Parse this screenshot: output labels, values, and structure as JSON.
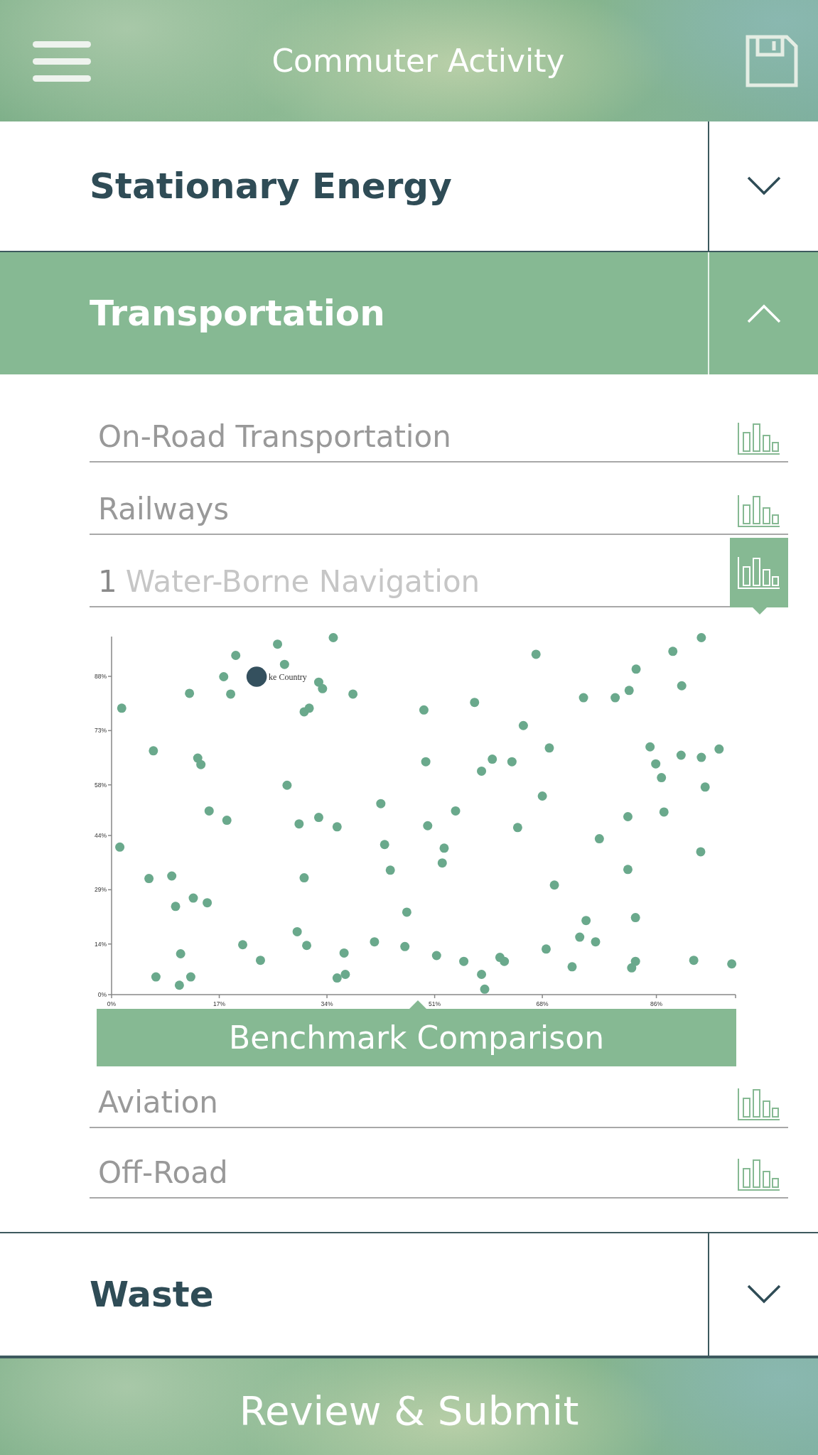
{
  "header": {
    "title": "Commuter Activity"
  },
  "sections": [
    {
      "title": "Stationary Energy",
      "expanded": false
    },
    {
      "title": "Transportation",
      "expanded": true,
      "items": [
        {
          "label": "On-Road Transportation",
          "selected": false
        },
        {
          "label": "Railways",
          "selected": false
        },
        {
          "label": "Water-Borne Navigation",
          "value": "1",
          "selected": true,
          "benchmark": {
            "button": "Benchmark Comparison",
            "chart_data": {
              "type": "scatter",
              "xlim": [
                0,
                98.5
              ],
              "ylim": [
                0,
                99
              ],
              "xticks": [
                {
                  "value": 0,
                  "label": "0%"
                },
                {
                  "value": 17,
                  "label": "17%"
                },
                {
                  "value": 34,
                  "label": "34%"
                },
                {
                  "value": 51,
                  "label": "51%"
                },
                {
                  "value": 68,
                  "label": "68%"
                },
                {
                  "value": 86,
                  "label": "86%"
                }
              ],
              "yticks": [
                {
                  "value": 0,
                  "label": "0%"
                },
                {
                  "value": 14,
                  "label": "14%"
                },
                {
                  "value": 29,
                  "label": "29%"
                },
                {
                  "value": 44,
                  "label": "44%"
                },
                {
                  "value": 58,
                  "label": "58%"
                },
                {
                  "value": 73,
                  "label": "73%"
                },
                {
                  "value": 88,
                  "label": "88%"
                }
              ],
              "series": [
                {
                  "color": "#6aa98c",
                  "x": [
                    1.6,
                    1.3,
                    5.9,
                    6.6,
                    7.0,
                    9.5,
                    10.1,
                    10.9,
                    10.7,
                    12.3,
                    12.5,
                    12.9,
                    13.6,
                    14.1,
                    15.1,
                    15.4,
                    17.7,
                    18.2,
                    18.8,
                    19.6,
                    20.7,
                    23.5,
                    26.2,
                    27.3,
                    27.7,
                    29.3,
                    29.6,
                    30.4,
                    30.4,
                    31.2,
                    30.8,
                    32.7,
                    33.3,
                    32.7,
                    35.6,
                    35.6,
                    36.7,
                    36.9,
                    38.1,
                    41.5,
                    42.5,
                    43.1,
                    44.0,
                    46.3,
                    46.6,
                    49.3,
                    49.6,
                    49.9,
                    51.3,
                    52.2,
                    52.5,
                    54.3,
                    55.6,
                    57.3,
                    58.4,
                    58.4,
                    58.9,
                    60.1,
                    61.3,
                    62.0,
                    63.2,
                    64.1,
                    65.0,
                    67.0,
                    68.0,
                    68.6,
                    69.1,
                    69.9,
                    72.7,
                    73.9,
                    74.5,
                    74.9,
                    76.4,
                    77.0,
                    79.5,
                    81.5,
                    81.7,
                    81.5,
                    82.1,
                    82.7,
                    82.8,
                    82.7,
                    85.0,
                    85.9,
                    87.2,
                    86.8,
                    88.6,
                    90.0,
                    89.9,
                    91.9,
                    93.0,
                    93.1,
                    93.7,
                    93.1,
                    95.9,
                    97.9,
                    35.0
                  ],
                  "values": [
                    79.2,
                    40.8,
                    32.1,
                    67.4,
                    4.9,
                    32.8,
                    24.4,
                    11.3,
                    2.6,
                    83.3,
                    4.9,
                    26.7,
                    65.4,
                    63.6,
                    25.4,
                    50.8,
                    87.9,
                    48.2,
                    83.1,
                    93.8,
                    13.8,
                    9.5,
                    96.9,
                    91.3,
                    57.9,
                    17.4,
                    47.2,
                    32.3,
                    78.2,
                    79.2,
                    13.6,
                    86.4,
                    84.6,
                    49.0,
                    46.4,
                    4.6,
                    11.5,
                    5.6,
                    83.1,
                    14.6,
                    52.8,
                    41.5,
                    34.4,
                    13.3,
                    22.8,
                    78.7,
                    64.4,
                    46.7,
                    10.8,
                    36.4,
                    40.5,
                    50.8,
                    9.2,
                    80.8,
                    5.6,
                    61.8,
                    1.5,
                    65.1,
                    10.3,
                    9.2,
                    64.4,
                    46.2,
                    74.4,
                    94.1,
                    54.9,
                    12.6,
                    68.2,
                    30.3,
                    7.7,
                    15.9,
                    82.1,
                    20.5,
                    14.6,
                    43.1,
                    82.1,
                    49.2,
                    84.1,
                    34.6,
                    7.4,
                    21.3,
                    90.0,
                    9.2,
                    68.5,
                    63.8,
                    50.5,
                    60.0,
                    94.9,
                    85.4,
                    66.2,
                    9.5,
                    39.5,
                    65.6,
                    57.4,
                    98.7,
                    67.9,
                    8.5,
                    98.7
                  ],
                  "marker": "circle"
                },
                {
                  "color": "#34505e",
                  "x": [
                    22.9
                  ],
                  "values": [
                    87.9
                  ],
                  "marker": "circle"
                }
              ],
              "annotations": [
                "ke Country"
              ]
            }
          }
        },
        {
          "label": "Aviation",
          "selected": false
        },
        {
          "label": "Off-Road",
          "selected": false
        }
      ]
    },
    {
      "title": "Waste",
      "expanded": false
    }
  ],
  "footer": {
    "button": "Review & Submit"
  }
}
